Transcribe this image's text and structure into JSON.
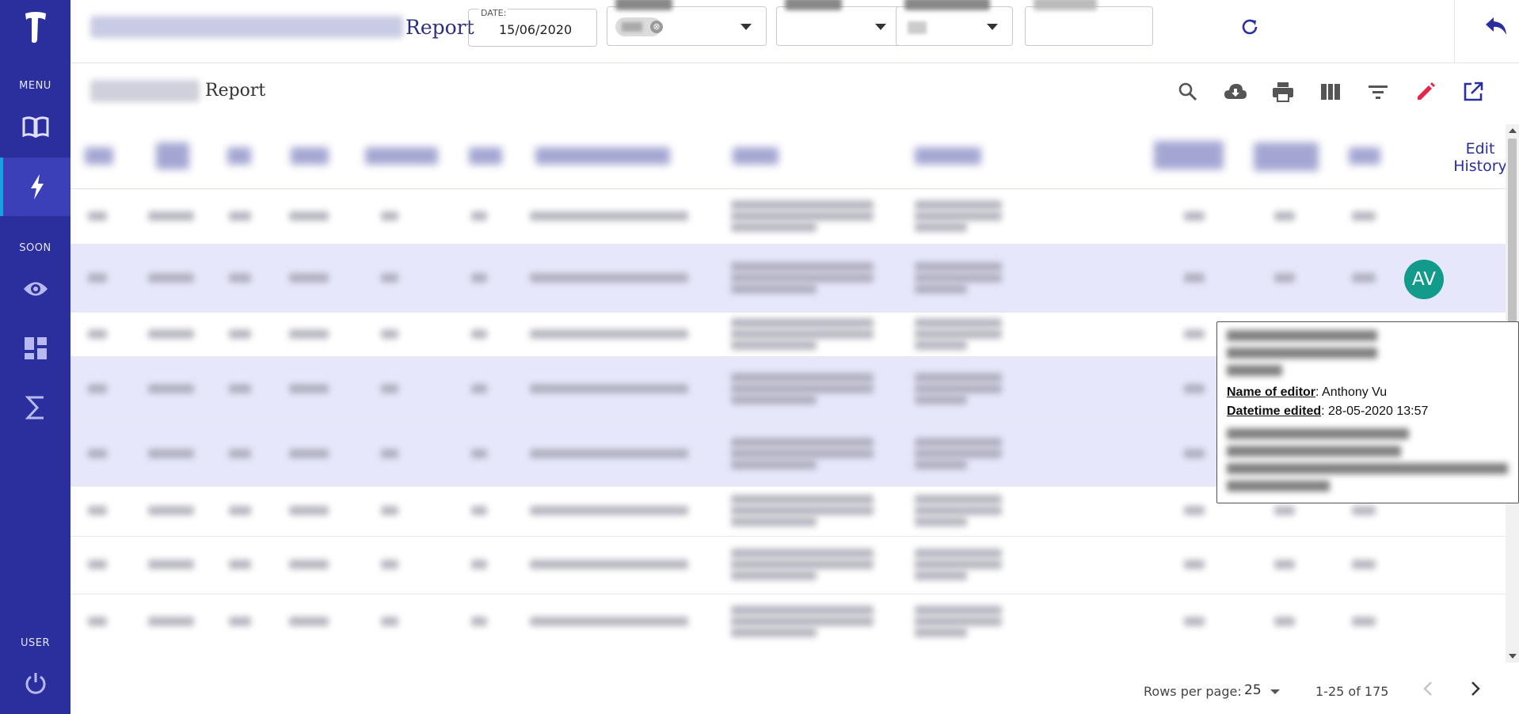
{
  "sidebar": {
    "logo_icon": "telstra-t-logo-icon",
    "menu_label": "MENU",
    "soon_label": "SOON",
    "user_label": "USER",
    "items": [
      {
        "name": "book-icon",
        "active": false
      },
      {
        "name": "lightning-icon",
        "active": true
      },
      {
        "name": "eye-icon",
        "active": false
      },
      {
        "name": "dashboard-icon",
        "active": false
      },
      {
        "name": "sigma-icon",
        "active": false
      },
      {
        "name": "power-icon",
        "active": false
      }
    ]
  },
  "header": {
    "report_title": "Report",
    "date_label": "DATE:",
    "date_value": "15/06/2020",
    "chip_close": "⊗"
  },
  "subheader": {
    "title": "Report",
    "tools": [
      "search-icon",
      "cloud-download-icon",
      "print-icon",
      "columns-icon",
      "filter-icon",
      "edit-pencil-icon",
      "open-external-icon"
    ]
  },
  "table": {
    "edit_history_header_line1": "Edit",
    "edit_history_header_line2": "History",
    "avatar_initials": "AV"
  },
  "tooltip": {
    "editor_key": "Name of editor",
    "editor_value": ": Anthony Vu",
    "datetime_key": "Datetime edited",
    "datetime_value": ": 28-05-2020 13:57"
  },
  "pagination": {
    "rows_per_page_label": "Rows per page:",
    "rows_per_page_value": "25",
    "range_text": "1-25 of 175"
  },
  "colors": {
    "sidebar": "#2b2f9e",
    "accent_red": "#e8244a",
    "avatar": "#129a8b",
    "row_highlight": "#e6e7fa"
  }
}
